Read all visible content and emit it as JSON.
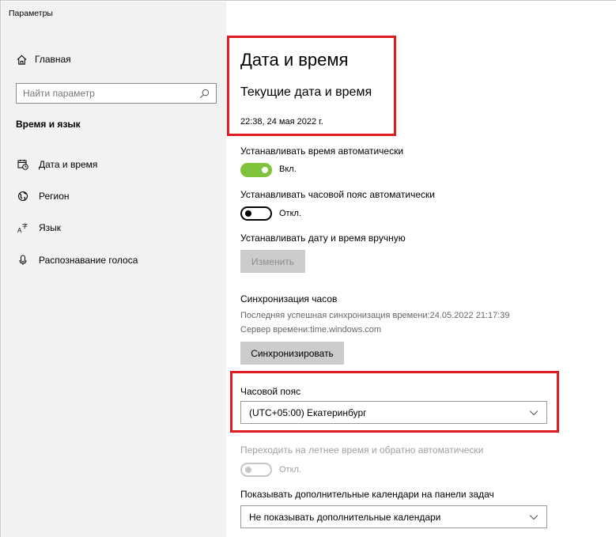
{
  "window": {
    "title": "Параметры"
  },
  "sidebar": {
    "home_label": "Главная",
    "search_placeholder": "Найти параметр",
    "section_title": "Время и язык",
    "items": [
      {
        "label": "Дата и время",
        "icon": "calendar-clock-icon"
      },
      {
        "label": "Регион",
        "icon": "globe-icon"
      },
      {
        "label": "Язык",
        "icon": "language-icon"
      },
      {
        "label": "Распознавание голоса",
        "icon": "microphone-icon"
      }
    ]
  },
  "main": {
    "title": "Дата и время",
    "subtitle": "Текущие дата и время",
    "current_datetime": "22:38, 24 мая 2022 г.",
    "auto_time": {
      "label": "Устанавливать время автоматически",
      "state_text": "Вкл.",
      "on": true
    },
    "auto_timezone": {
      "label": "Устанавливать часовой пояс автоматически",
      "state_text": "Откл.",
      "on": false
    },
    "manual": {
      "label": "Устанавливать дату и время вручную",
      "button": "Изменить"
    },
    "sync": {
      "title": "Синхронизация часов",
      "last_sync": "Последняя успешная синхронизация времени:24.05.2022 21:17:39",
      "server": "Сервер времени:time.windows.com",
      "button": "Синхронизировать"
    },
    "timezone": {
      "label": "Часовой пояс",
      "value": "(UTC+05:00) Екатеринбург"
    },
    "dst": {
      "label": "Переходить на летнее время и обратно автоматически",
      "state_text": "Откл."
    },
    "calendars": {
      "label": "Показывать дополнительные календари на панели задач",
      "value": "Не показывать дополнительные календари"
    }
  },
  "colors": {
    "accent_on": "#7ec33a",
    "highlight_box": "#e21a22",
    "sidebar_bg": "#f2f2f2"
  }
}
